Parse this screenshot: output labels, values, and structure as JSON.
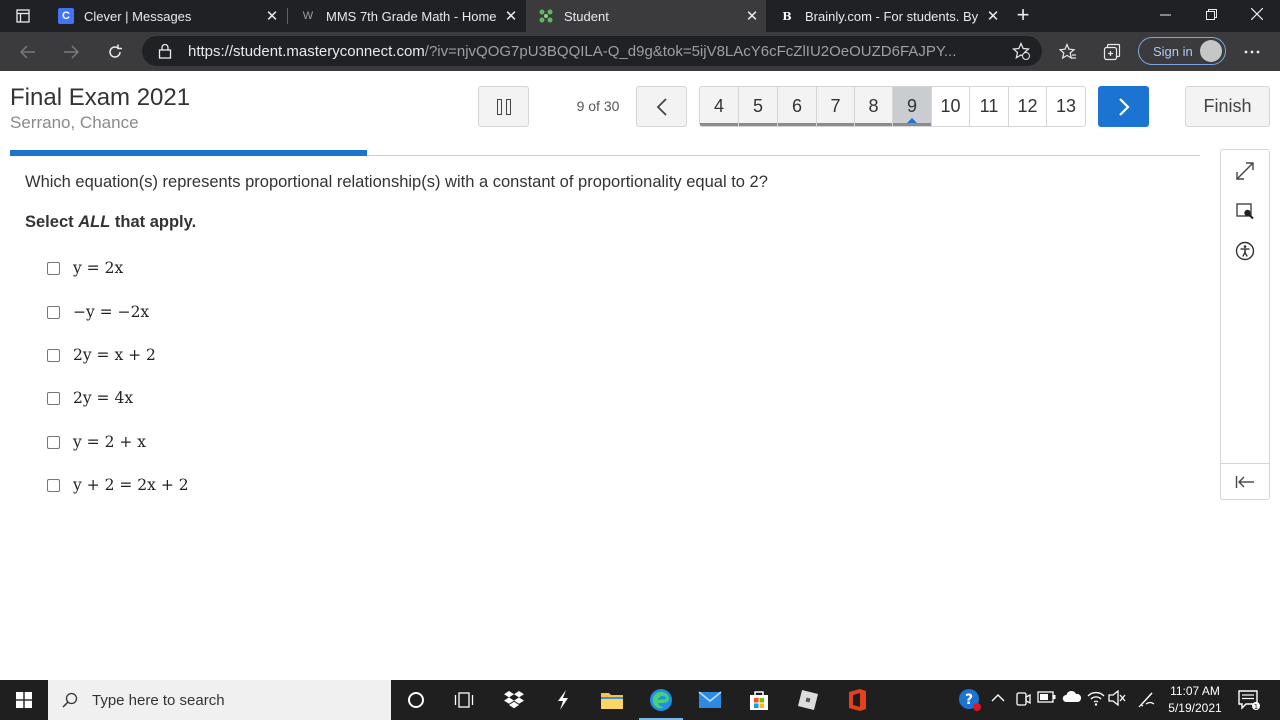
{
  "browser": {
    "tabs": [
      {
        "title": "Clever | Messages",
        "favicon": "clever-icon",
        "active": false
      },
      {
        "title": "MMS 7th Grade Math - Home",
        "favicon": "schoology-icon",
        "active": false
      },
      {
        "title": "Student",
        "favicon": "masteryconnect-icon",
        "active": true
      },
      {
        "title": "Brainly.com - For students. By st",
        "favicon": "brainly-icon",
        "active": false
      }
    ],
    "url_host": "https://student.masteryconnect.com",
    "url_rest": "/?iv=njvQOG7pU3BQQILA-Q_d9g&tok=5ijV8LAcY6cFcZlIU2OeOUZD6FAJPY...",
    "signin_label": "Sign in"
  },
  "exam": {
    "title": "Final Exam 2021",
    "student": "Serrano, Chance",
    "counter": "9 of 30",
    "question_numbers": [
      "4",
      "5",
      "6",
      "7",
      "8",
      "9",
      "10",
      "11",
      "12",
      "13"
    ],
    "current_question": "9",
    "finish_label": "Finish",
    "progress_fraction": 0.3
  },
  "question": {
    "text": "Which equation(s) represents proportional relationship(s) with a constant of proportionality equal to 2?",
    "instruction_prefix": "Select ",
    "instruction_emphasis": "ALL",
    "instruction_suffix": " that apply.",
    "options": [
      {
        "eq": "y = 2x",
        "checked": false
      },
      {
        "eq": "−y = −2x",
        "checked": false
      },
      {
        "eq": "2y = x + 2",
        "checked": false
      },
      {
        "eq": "2y = 4x",
        "checked": false
      },
      {
        "eq": "y = 2 + x",
        "checked": false
      },
      {
        "eq": "y + 2 = 2x + 2",
        "checked": false
      }
    ]
  },
  "taskbar": {
    "search_placeholder": "Type here to search",
    "time": "11:07 AM",
    "date": "5/19/2021"
  },
  "colors": {
    "accent": "#1b74d1",
    "tabstrip": "#202124",
    "toolbar": "#3b3b3d"
  }
}
